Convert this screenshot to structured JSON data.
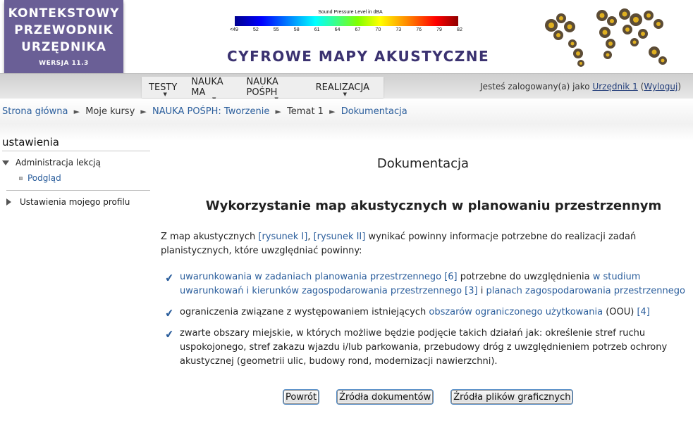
{
  "logo": {
    "line1": "KONTEKSTOWY",
    "line2": "PRZEWODNIK",
    "line3": "URZĘDNIKA",
    "version": "WERSJA 11.3"
  },
  "legend": {
    "title": "Sound Pressure Level in dBA",
    "ticks": [
      "<49",
      "52",
      "55",
      "58",
      "61",
      "64",
      "67",
      "70",
      "73",
      "76",
      "79",
      "82"
    ]
  },
  "site_title": "CYFROWE MAPY AKUSTYCZNE",
  "nav": {
    "items": [
      {
        "label": "TESTY"
      },
      {
        "label": "NAUKA MA"
      },
      {
        "label": "NAUKA POŚPH"
      },
      {
        "label": "REALIZACJA"
      }
    ]
  },
  "login": {
    "prefix": "Jesteś zalogowany(a) jako ",
    "user": "Urzędnik 1",
    "open": " (",
    "logout": "Wyloguj",
    "close": ")"
  },
  "breadcrumb": {
    "items": [
      "Strona główna",
      "Moje kursy",
      "NAUKA POŚPH: Tworzenie",
      "Temat 1",
      "Dokumentacja"
    ]
  },
  "sidebar": {
    "title": "ustawienia",
    "admin_label": "Administracja lekcją",
    "preview_label": "Podgląd",
    "profile_label": "Ustawienia mojego profilu"
  },
  "main": {
    "page_heading": "Dokumentacja",
    "section_heading": "Wykorzystanie map akustycznych w planowaniu przestrzennym",
    "intro": {
      "t1": "Z map akustycznych ",
      "link1": "[rysunek I]",
      "t2": ", ",
      "link2": "[rysunek II]",
      "t3": " wynikać powinny informacje potrzebne do realizacji zadań planistycznych, które uwzględniać powinny:"
    },
    "item1": {
      "link1": "uwarunkowania w zadaniach planowania przestrzennego [6]",
      "t1": " potrzebne do uwzględnienia ",
      "link2": "w studium uwarunkowań i kierunków zagospodarowania przestrzennego [3]",
      "t2": " i ",
      "link3": "planach zagospodarowania przestrzennego"
    },
    "item2": {
      "t1": "ograniczenia związane z występowaniem istniejących ",
      "link1": "obszarów ograniczonego użytkowania",
      "t2": " (OOU) ",
      "link2": "[4]"
    },
    "item3": {
      "t1": "zwarte obszary miejskie, w których możliwe będzie podjęcie takich działań jak: określenie stref ruchu uspokojonego, stref zakazu wjazdu i/lub parkowania, przebudowy dróg z uwzględnieniem potrzeb ochrony akustycznej (geometrii ulic, budowy rond, modernizacji nawierzchni)."
    }
  },
  "buttons": {
    "back": "Powrót",
    "doc_sources": "Źródła dokumentów",
    "graphic_sources": "Źródła plików graficznych"
  }
}
